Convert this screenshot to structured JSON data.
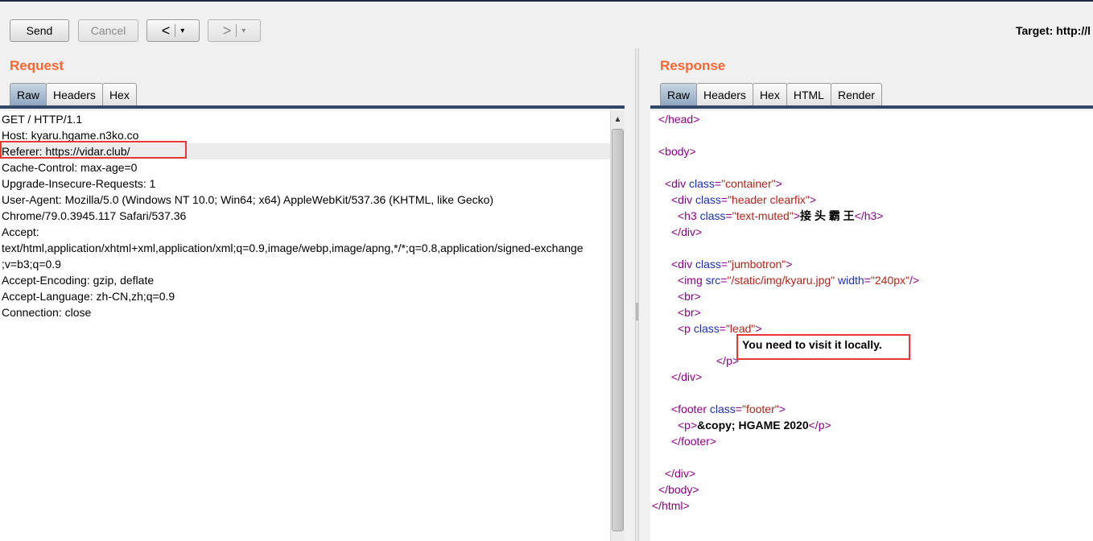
{
  "toolbar": {
    "send_label": "Send",
    "cancel_label": "Cancel",
    "back_label": "<",
    "forward_label": ">",
    "dropdown_glyph": "▾",
    "target_label": "Target: http://l"
  },
  "request": {
    "title": "Request",
    "tabs": [
      "Raw",
      "Headers",
      "Hex"
    ],
    "active_tab": "Raw",
    "lines": [
      "GET / HTTP/1.1",
      "Host: kyaru.hgame.n3ko.co",
      "Referer: https://vidar.club/",
      "Cache-Control: max-age=0",
      "Upgrade-Insecure-Requests: 1",
      "User-Agent: Mozilla/5.0 (Windows NT 10.0; Win64; x64) AppleWebKit/537.36 (KHTML, like Gecko)",
      "Chrome/79.0.3945.117 Safari/537.36",
      "Accept:",
      "text/html,application/xhtml+xml,application/xml;q=0.9,image/webp,image/apng,*/*;q=0.8,application/signed-exchange",
      ";v=b3;q=0.9",
      "Accept-Encoding: gzip, deflate",
      "Accept-Language: zh-CN,zh;q=0.9",
      "Connection: close"
    ],
    "highlighted_line_index": 2,
    "scroll_up_glyph": "▲"
  },
  "response": {
    "title": "Response",
    "tabs": [
      "Raw",
      "Headers",
      "Hex",
      "HTML",
      "Render"
    ],
    "active_tab": "Raw",
    "code": {
      "head_close": "</head>",
      "body_open": "<body>",
      "div_container": {
        "open": "<div ",
        "attr": "class",
        "eq": "=",
        "val": "\"container\"",
        "close": ">"
      },
      "div_header": {
        "open": "<div ",
        "attr": "class",
        "eq": "=",
        "val": "\"header clearfix\"",
        "close": ">"
      },
      "h3": {
        "open": "<h3 ",
        "attr": "class",
        "eq": "=",
        "val": "\"text-muted\"",
        "close": ">",
        "text": "接 头 霸 王",
        "end": "</h3>"
      },
      "div_close_1": "</div>",
      "div_jumbotron": {
        "open": "<div ",
        "attr": "class",
        "eq": "=",
        "val": "\"jumbotron\"",
        "close": ">"
      },
      "img": {
        "open": "<img ",
        "attr1": "src",
        "val1": "\"/static/img/kyaru.jpg\"",
        "attr2": "width",
        "val2": "\"240px\"",
        "close": "/>"
      },
      "br1": "<br>",
      "br2": "<br>",
      "p_lead": {
        "open": "<p ",
        "attr": "class",
        "eq": "=",
        "val": "\"lead\"",
        "close": ">"
      },
      "lead_text": "You need to visit it locally.",
      "p_close": "</p>",
      "div_close_2": "</div>",
      "footer_open": {
        "open": "<footer ",
        "attr": "class",
        "eq": "=",
        "val": "\"footer\"",
        "close": ">"
      },
      "footer_p": {
        "open": "<p>",
        "text": "&copy; HGAME 2020",
        "end": "</p>"
      },
      "footer_close": "</footer>",
      "div_close_3": "</div>",
      "body_close": "</body>",
      "html_close": "</html>"
    }
  },
  "colors": {
    "section_title": "#ff6633",
    "tag": "#8b008b",
    "attr_name": "#1a2fb5",
    "attr_value": "#b0251b",
    "highlight_box": "#e53935"
  }
}
